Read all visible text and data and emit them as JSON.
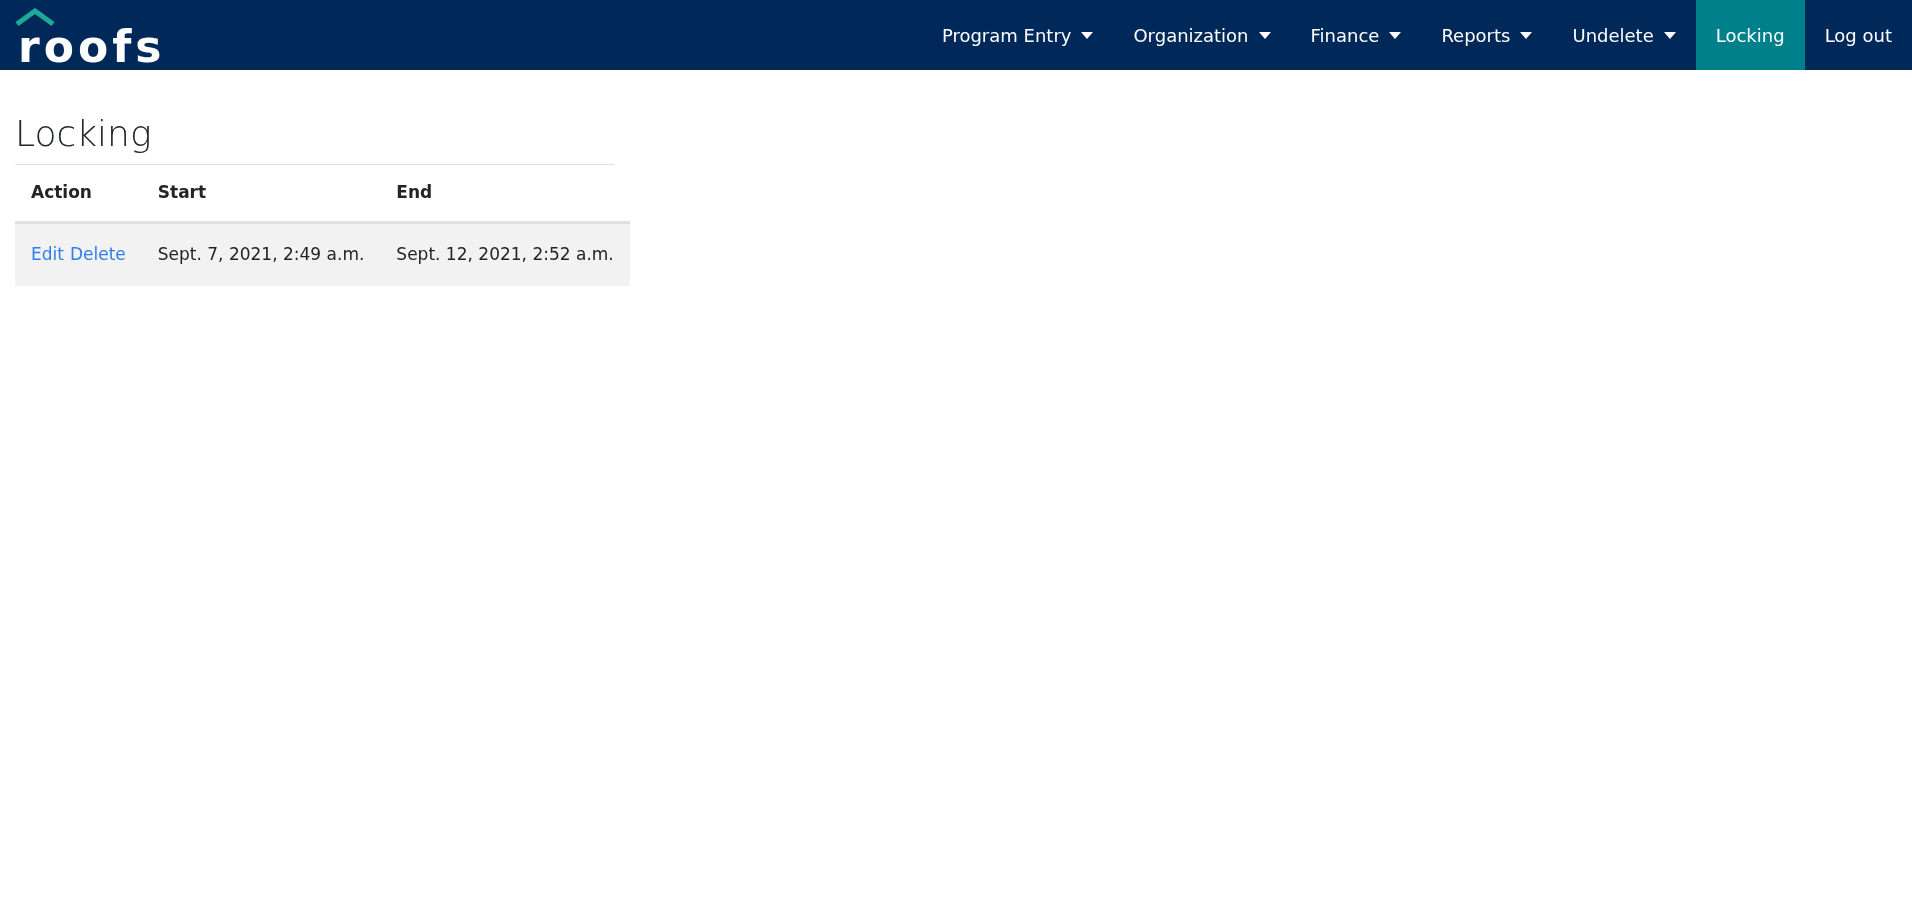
{
  "logo": {
    "text": "roofs"
  },
  "nav": [
    {
      "label": "Program Entry",
      "dropdown": true,
      "selected": false
    },
    {
      "label": "Organization",
      "dropdown": true,
      "selected": false
    },
    {
      "label": "Finance",
      "dropdown": true,
      "selected": false
    },
    {
      "label": "Reports",
      "dropdown": true,
      "selected": false
    },
    {
      "label": "Undelete",
      "dropdown": true,
      "selected": false
    },
    {
      "label": "Locking",
      "dropdown": false,
      "selected": true
    },
    {
      "label": "Log out",
      "dropdown": false,
      "selected": false
    }
  ],
  "page_title": "Locking",
  "table": {
    "columns": [
      "Action",
      "Start",
      "End"
    ],
    "rows": [
      {
        "actions": [
          "Edit",
          "Delete"
        ],
        "start": "Sept. 7, 2021, 2:49 a.m.",
        "end": "Sept. 12, 2021, 2:52 a.m."
      }
    ]
  }
}
